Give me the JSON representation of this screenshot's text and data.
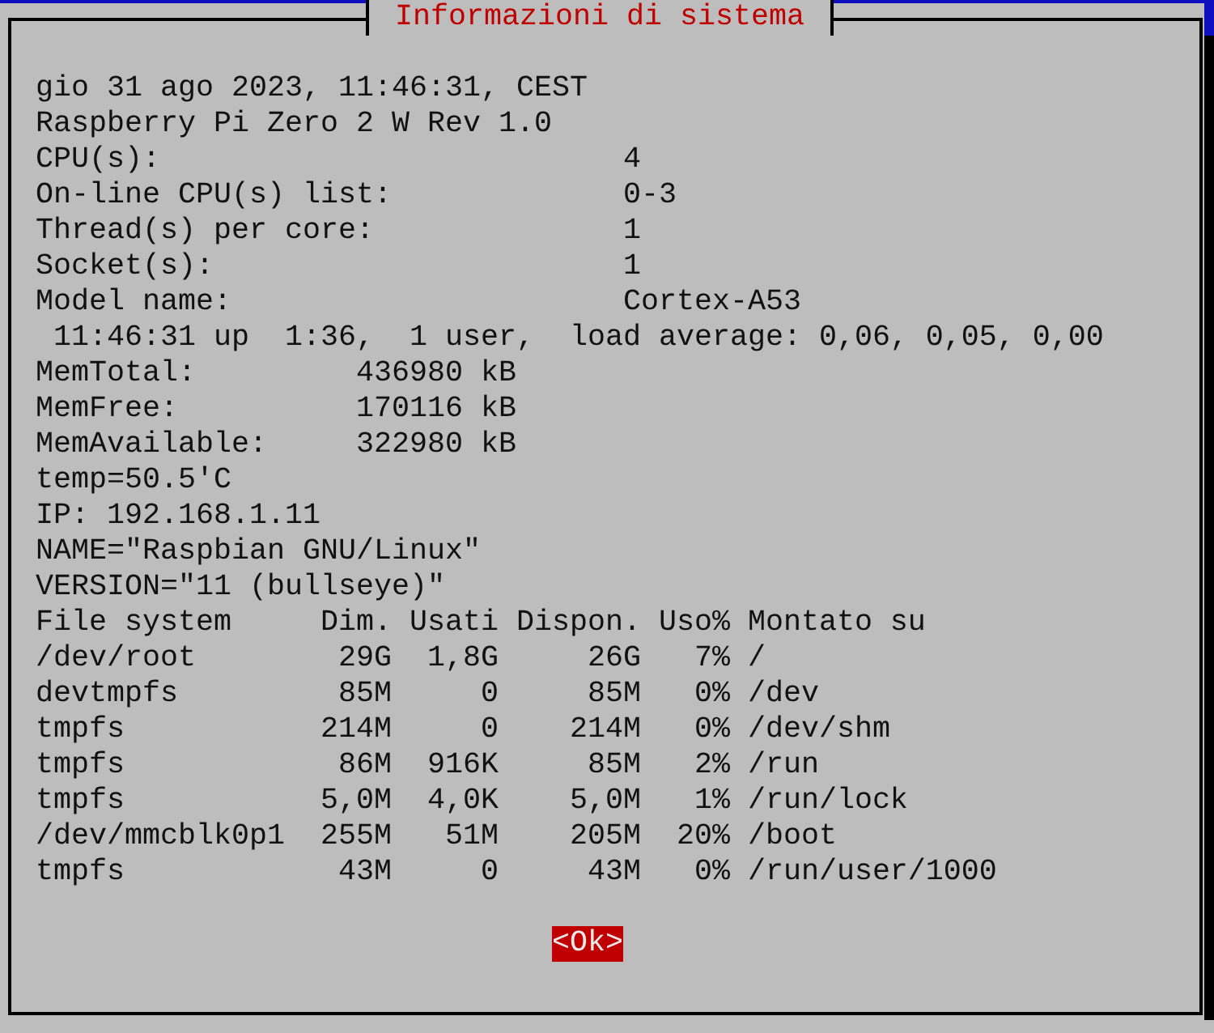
{
  "dialog": {
    "title": "Informazioni di sistema",
    "lines": [
      "gio 31 ago 2023, 11:46:31, CEST",
      "Raspberry Pi Zero 2 W Rev 1.0",
      "CPU(s):                          4",
      "On-line CPU(s) list:             0-3",
      "Thread(s) per core:              1",
      "Socket(s):                       1",
      "Model name:                      Cortex-A53",
      " 11:46:31 up  1:36,  1 user,  load average: 0,06, 0,05, 0,00",
      "MemTotal:         436980 kB",
      "MemFree:          170116 kB",
      "MemAvailable:     322980 kB",
      "temp=50.5'C",
      "IP: 192.168.1.11",
      "NAME=\"Raspbian GNU/Linux\"",
      "VERSION=\"11 (bullseye)\"",
      "File system     Dim. Usati Dispon. Uso% Montato su",
      "/dev/root        29G  1,8G     26G   7% /",
      "devtmpfs         85M     0     85M   0% /dev",
      "tmpfs           214M     0    214M   0% /dev/shm",
      "tmpfs            86M  916K     85M   2% /run",
      "tmpfs           5,0M  4,0K    5,0M   1% /run/lock",
      "/dev/mmcblk0p1  255M   51M    205M  20% /boot",
      "tmpfs            43M     0     43M   0% /run/user/1000"
    ],
    "button": "<Ok>"
  }
}
